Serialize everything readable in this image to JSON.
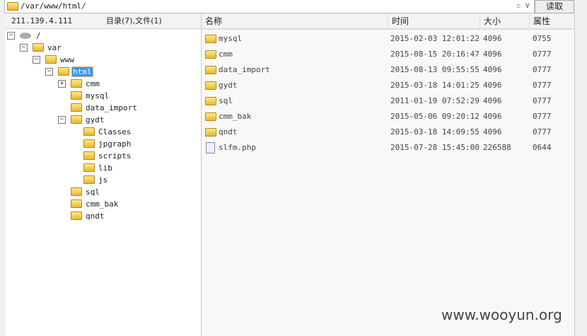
{
  "address": {
    "path": "/var/www/html/",
    "read_button": "读取",
    "dropdown": "±"
  },
  "tree": {
    "host": "211.139.4.111",
    "summary": "目录(7),文件(1)",
    "nodes": [
      {
        "label": "/",
        "level": 0,
        "toggle": "−",
        "type": "drive"
      },
      {
        "label": "var",
        "level": 1,
        "toggle": "−"
      },
      {
        "label": "www",
        "level": 2,
        "toggle": "−"
      },
      {
        "label": "html",
        "level": 3,
        "toggle": "−",
        "selected": true
      },
      {
        "label": "cmm",
        "level": 4,
        "toggle": "+"
      },
      {
        "label": "mysql",
        "level": 4
      },
      {
        "label": "data_import",
        "level": 4
      },
      {
        "label": "gydt",
        "level": 4,
        "toggle": "−"
      },
      {
        "label": "Classes",
        "level": 5
      },
      {
        "label": "jpgraph",
        "level": 5
      },
      {
        "label": "scripts",
        "level": 5
      },
      {
        "label": "lib",
        "level": 5
      },
      {
        "label": "js",
        "level": 5
      },
      {
        "label": "sql",
        "level": 4
      },
      {
        "label": "cmm_bak",
        "level": 4
      },
      {
        "label": "qndt",
        "level": 4
      }
    ]
  },
  "files": {
    "columns": [
      "名称",
      "时间",
      "大小",
      "属性"
    ],
    "rows": [
      [
        "mysql",
        "2015-02-03 12:01:22",
        "4096",
        "0755",
        "folder"
      ],
      [
        "cmm",
        "2015-08-15 20:16:47",
        "4096",
        "0777",
        "folder"
      ],
      [
        "data_import",
        "2015-08-13 09:55:55",
        "4096",
        "0777",
        "folder"
      ],
      [
        "gydt",
        "2015-03-18 14:01:25",
        "4096",
        "0777",
        "folder"
      ],
      [
        "sql",
        "2011-01-19 07:52:29",
        "4096",
        "0777",
        "folder"
      ],
      [
        "cmm_bak",
        "2015-05-06 09:20:12",
        "4096",
        "0777",
        "folder"
      ],
      [
        "qndt",
        "2015-03-18 14:09:55",
        "4096",
        "0777",
        "folder"
      ],
      [
        "slfm.php",
        "2015-07-28 15:45:00",
        "226588",
        "0644",
        "file"
      ]
    ]
  },
  "watermark": "www.wooyun.org"
}
